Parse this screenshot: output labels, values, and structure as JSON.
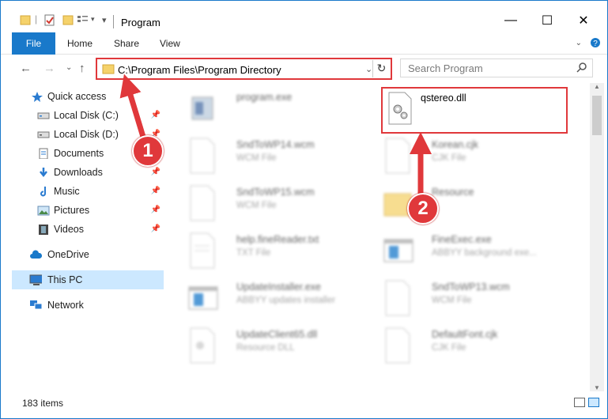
{
  "window": {
    "title": "Program",
    "controls": {
      "minimize": "—",
      "maximize": "☐",
      "close": "✕"
    }
  },
  "ribbon": {
    "tabs": [
      "File",
      "Home",
      "Share",
      "View"
    ]
  },
  "address": {
    "path": "C:\\Program Files\\Program Directory",
    "refresh": "↻"
  },
  "search": {
    "placeholder": "Search Program"
  },
  "sidebar": {
    "items": [
      {
        "label": "Quick access",
        "icon": "star-icon",
        "pinned": false
      },
      {
        "label": "Local Disk (C:)",
        "icon": "drive-icon",
        "pinned": true
      },
      {
        "label": "Local Disk (D:)",
        "icon": "drive-icon",
        "pinned": true
      },
      {
        "label": "Documents",
        "icon": "documents-icon",
        "pinned": true
      },
      {
        "label": "Downloads",
        "icon": "download-icon",
        "pinned": true
      },
      {
        "label": "Music",
        "icon": "music-icon",
        "pinned": true
      },
      {
        "label": "Pictures",
        "icon": "pictures-icon",
        "pinned": true
      },
      {
        "label": "Videos",
        "icon": "videos-icon",
        "pinned": true
      },
      {
        "label": "OneDrive",
        "icon": "cloud-icon",
        "pinned": false
      },
      {
        "label": "This PC",
        "icon": "computer-icon",
        "pinned": false,
        "selected": true
      },
      {
        "label": "Network",
        "icon": "network-icon",
        "pinned": false
      }
    ]
  },
  "files": [
    {
      "name": "program.exe",
      "type": "",
      "icon": "exe-icon"
    },
    {
      "name": "qstereo.dll",
      "type": "",
      "icon": "dll-gear-icon",
      "highlighted": true
    },
    {
      "name": "SndToWP14.wcm",
      "type": "WCM File",
      "icon": "document-icon"
    },
    {
      "name": "Korean.cjk",
      "type": "CJK File",
      "icon": "document-icon"
    },
    {
      "name": "SndToWP15.wcm",
      "type": "WCM File",
      "icon": "document-icon"
    },
    {
      "name": "Resource",
      "type": "",
      "icon": "folder-icon"
    },
    {
      "name": "help.fineReader.txt",
      "type": "TXT File",
      "icon": "text-icon"
    },
    {
      "name": "FineExec.exe",
      "type": "ABBYY background exe...",
      "icon": "app-window-icon"
    },
    {
      "name": "UpdateInstaller.exe",
      "type": "ABBYY updates installer",
      "icon": "app-window-icon"
    },
    {
      "name": "SndToWP13.wcm",
      "type": "WCM File",
      "icon": "document-icon"
    },
    {
      "name": "UpdateClient65.dll",
      "type": "Resource DLL",
      "icon": "dll-gear-icon"
    },
    {
      "name": "DefaultFont.cjk",
      "type": "CJK File",
      "icon": "document-icon"
    }
  ],
  "status": {
    "items_count": "183 items"
  },
  "callouts": [
    "1",
    "2"
  ],
  "colors": {
    "accent": "#1979ca",
    "highlight": "#e0383b",
    "selected_bg": "#cce8ff"
  }
}
